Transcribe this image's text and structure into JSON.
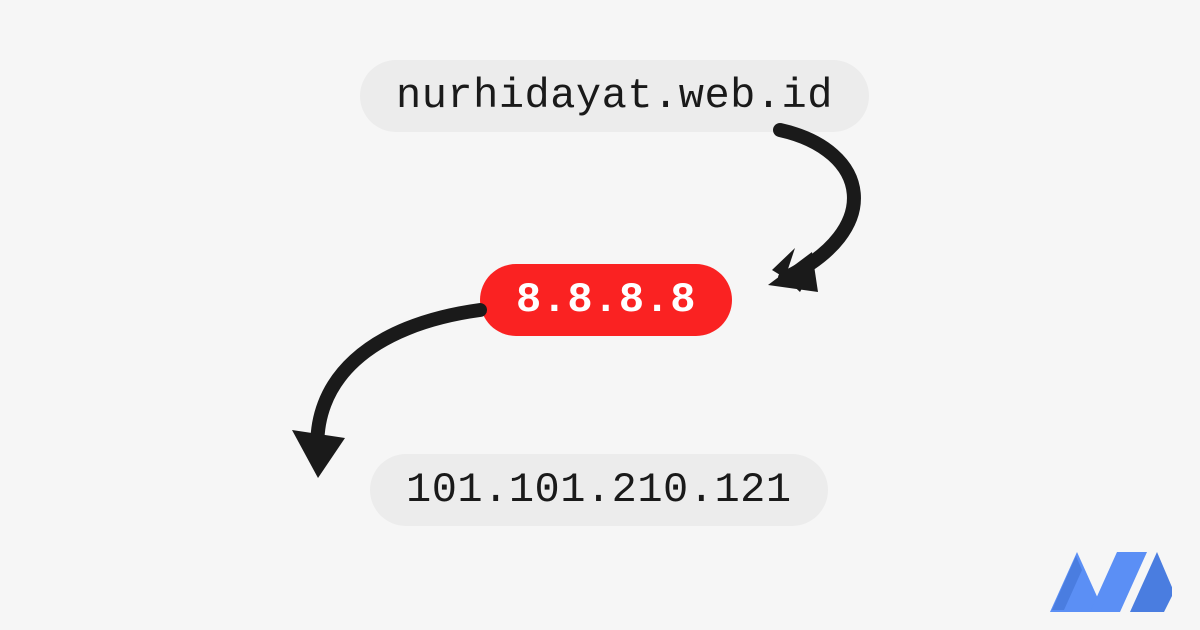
{
  "nodes": {
    "domain": "nurhidayat.web.id",
    "dns_server": "8.8.8.8",
    "resolved_ip": "101.101.210.121"
  },
  "colors": {
    "background": "#f6f6f6",
    "pill_gray_bg": "#ececec",
    "pill_red_bg": "#fa2222",
    "arrow": "#1a1a1a",
    "logo": "#5b8ff5"
  },
  "icons": {
    "arrow1": "arrow-down-right-curve-icon",
    "arrow2": "arrow-down-left-curve-icon",
    "brand": "brand-n-logo"
  }
}
